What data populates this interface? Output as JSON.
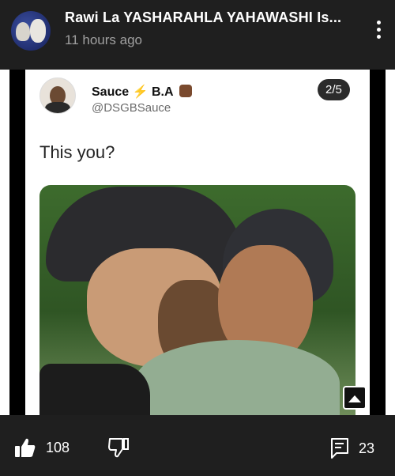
{
  "header": {
    "title": "Rawi La YASHARAHLA YAHAWASHI Is...",
    "timestamp": "11 hours ago",
    "more_icon": "kebab-menu-icon"
  },
  "tweet": {
    "display_name": "Sauce",
    "display_name_suffix": "B.A",
    "handle": "@DSGBSauce",
    "text": "This you?",
    "page_indicator": "2/5"
  },
  "footer": {
    "likes": "108",
    "comments": "23",
    "like_icon": "thumbs-up-icon",
    "dislike_icon": "thumbs-down-icon",
    "comment_icon": "comment-icon"
  },
  "colors": {
    "background": "#1f1f1f",
    "stage": "#000000",
    "card": "#ffffff",
    "bolt": "#f2b300"
  }
}
